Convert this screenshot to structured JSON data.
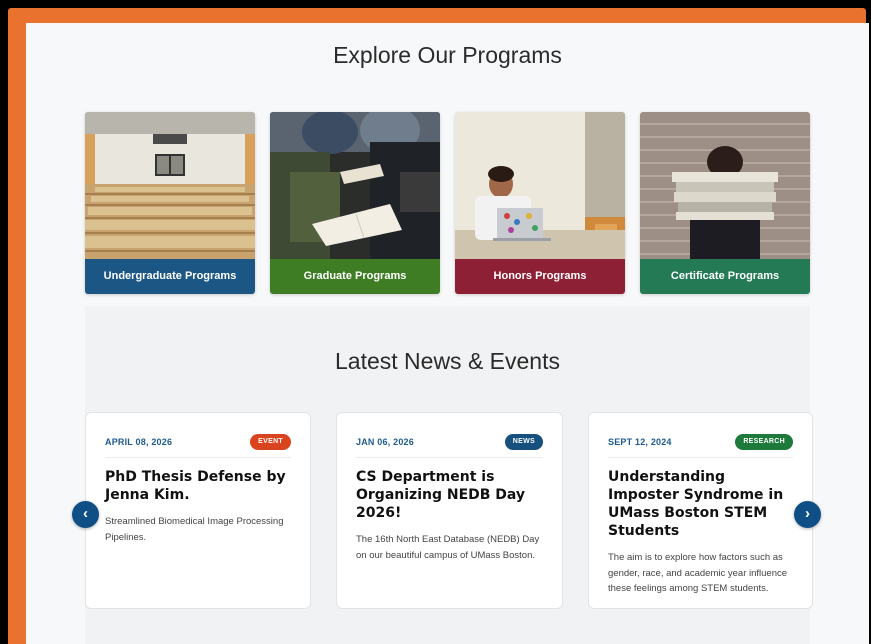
{
  "programs": {
    "title": "Explore Our Programs",
    "cards": [
      {
        "label": "Undergraduate Programs",
        "color": "#1c5685",
        "image": "lecture-hall"
      },
      {
        "label": "Graduate Programs",
        "color": "#3f7d25",
        "image": "students-notebooks"
      },
      {
        "label": "Honors Programs",
        "color": "#8e2035",
        "image": "student-laptop"
      },
      {
        "label": "Certificate Programs",
        "color": "#237a55",
        "image": "person-books"
      }
    ]
  },
  "news": {
    "title": "Latest News & Events",
    "prev_icon": "‹",
    "next_icon": "›",
    "items": [
      {
        "date": "APRIL 08, 2026",
        "badge": "EVENT",
        "badge_color": "#d9441f",
        "title": "PhD Thesis Defense by Jenna Kim.",
        "description": "Streamlined Biomedical Image Processing Pipelines."
      },
      {
        "date": "JAN 06, 2026",
        "badge": "NEWS",
        "badge_color": "#15507f",
        "title": "CS Department is Organizing NEDB Day 2026!",
        "description": "The 16th North East Database (NEDB) Day on our beautiful campus of UMass Boston."
      },
      {
        "date": "SEPT 12, 2024",
        "badge": "RESEARCH",
        "badge_color": "#1e7a3a",
        "title": "Understanding Imposter Syndrome in UMass Boston STEM Students",
        "description": "The aim is to explore how factors such as gender, race, and academic year influence these feelings among STEM students."
      }
    ]
  }
}
